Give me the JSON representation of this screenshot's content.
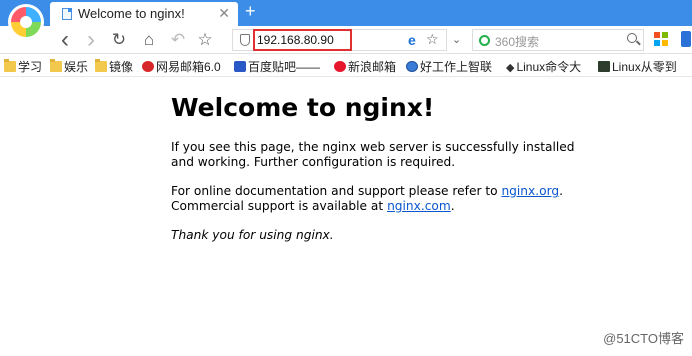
{
  "browser": {
    "tab_title": "Welcome to nginx!",
    "tab_close": "✕",
    "new_tab": "+",
    "url": "192.168.80.90",
    "search_placeholder": "360搜索",
    "nav": {
      "back": "‹",
      "forward": "›",
      "reload": "↻",
      "home": "⌂",
      "undo": "↶",
      "star": "☆"
    },
    "address_icons": {
      "e": "e",
      "star": "☆",
      "dropdown": "⌄"
    }
  },
  "bookmarks": [
    {
      "label": "学习",
      "icon": "folder-icon"
    },
    {
      "label": "娱乐",
      "icon": "folder-icon"
    },
    {
      "label": "镜像",
      "icon": "folder-icon"
    },
    {
      "label": "网易邮箱6.0",
      "icon": "netease-icon"
    },
    {
      "label": "百度贴吧——",
      "icon": "baidu-icon"
    },
    {
      "label": "新浪邮箱",
      "icon": "weibo-icon"
    },
    {
      "label": "好工作上智联",
      "icon": "zhilian-icon"
    },
    {
      "label": "Linux命令大",
      "icon": "penguin-icon"
    },
    {
      "label": "Linux从零到",
      "icon": "linux-book-icon"
    }
  ],
  "page": {
    "heading": "Welcome to nginx!",
    "p1": "If you see this page, the nginx web server is successfully installed and working. Further configuration is required.",
    "p2_before": "For online documentation and support please refer to ",
    "link1": "nginx.org",
    "p2_mid": ".\nCommercial support is available at ",
    "link2": "nginx.com",
    "p2_end": ".",
    "thanks": "Thank you for using nginx."
  },
  "watermark": "@51CTO博客"
}
